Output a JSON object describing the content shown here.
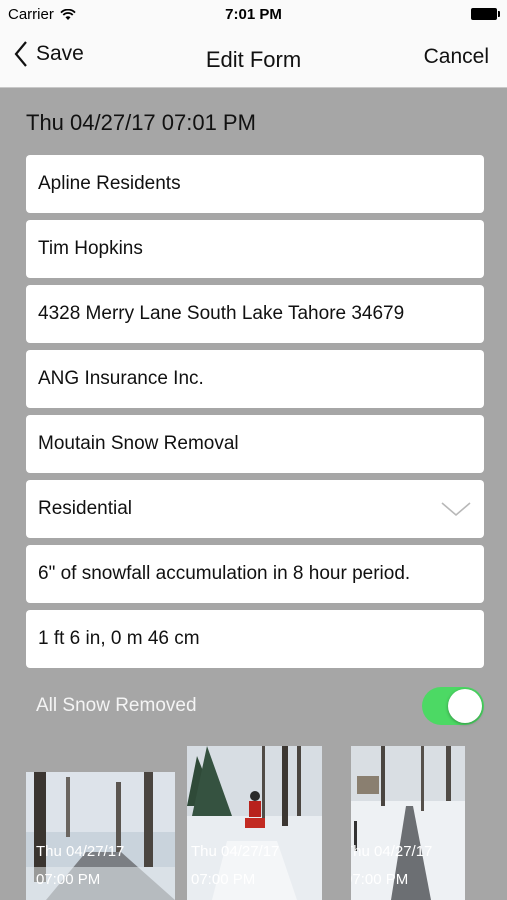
{
  "status_bar": {
    "carrier": "Carrier",
    "time": "7:01 PM"
  },
  "nav": {
    "save_label": "Save",
    "title": "Edit Form",
    "cancel_label": "Cancel"
  },
  "date_time": "Thu 04/27/17 07:01 PM",
  "fields": [
    {
      "value": "Apline Residents"
    },
    {
      "value": "Tim Hopkins"
    },
    {
      "value": "4328 Merry Lane South Lake Tahore 34679"
    },
    {
      "value": "ANG Insurance Inc."
    },
    {
      "value": "Moutain Snow Removal"
    },
    {
      "value": "Residential"
    },
    {
      "value": "6\" of snowfall accumulation in 8 hour period."
    },
    {
      "value": "1 ft 6 in, 0 m 46 cm"
    }
  ],
  "toggle": {
    "label": "All Snow Removed",
    "on": true
  },
  "photos": [
    {
      "date": "Thu 04/27/17",
      "time": "07:00 PM"
    },
    {
      "date": "Thu 04/27/17",
      "time": "07:00 PM"
    },
    {
      "date": "Thu 04/27/17",
      "time": "07:00 PM"
    }
  ],
  "colors": {
    "background": "#a6a6a6",
    "switch_on": "#4cd964",
    "bar": "#fafafa"
  }
}
